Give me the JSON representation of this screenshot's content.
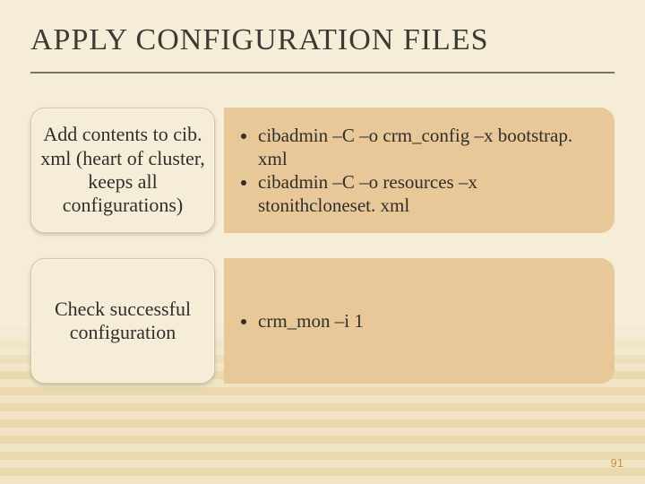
{
  "title": "APPLY CONFIGURATION FILES",
  "rows": [
    {
      "heading": "Add contents to cib. xml (heart of cluster, keeps all configurations)",
      "bullets": [
        "cibadmin –C –o crm_config –x bootstrap. xml",
        "cibadmin –C –o resources –x stonithcloneset. xml"
      ]
    },
    {
      "heading": "Check successful configuration",
      "bullets": [
        "crm_mon –i 1"
      ]
    }
  ],
  "page_number": "91"
}
